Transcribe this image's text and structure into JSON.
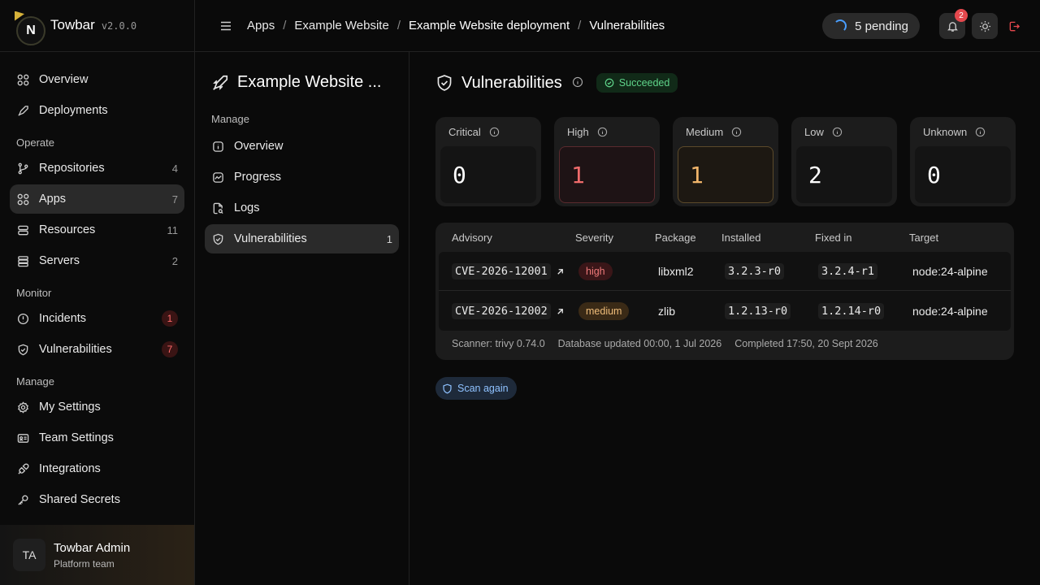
{
  "brand": {
    "name": "Towbar",
    "version": "v2.0.0",
    "logo_letter": "N"
  },
  "sidebar": {
    "top": [
      {
        "label": "Overview",
        "icon": "grid-icon"
      },
      {
        "label": "Deployments",
        "icon": "rocket-icon"
      }
    ],
    "operate_title": "Operate",
    "operate": [
      {
        "label": "Repositories",
        "count": "4"
      },
      {
        "label": "Apps",
        "count": "7"
      },
      {
        "label": "Resources",
        "count": "11"
      },
      {
        "label": "Servers",
        "count": "2"
      }
    ],
    "monitor_title": "Monitor",
    "monitor": [
      {
        "label": "Incidents",
        "count": "1"
      },
      {
        "label": "Vulnerabilities",
        "count": "7"
      }
    ],
    "manage_title": "Manage",
    "manage": [
      {
        "label": "My Settings"
      },
      {
        "label": "Team Settings"
      },
      {
        "label": "Integrations"
      },
      {
        "label": "Shared Secrets"
      }
    ],
    "user": {
      "initials": "TA",
      "name": "Towbar Admin",
      "team": "Platform team"
    }
  },
  "header": {
    "breadcrumbs": [
      "Apps",
      "Example Website",
      "Example Website deployment",
      "Vulnerabilities"
    ],
    "pending": "5 pending",
    "notif_count": "2"
  },
  "subnav": {
    "title": "Example Website ...",
    "section": "Manage",
    "items": [
      {
        "label": "Overview"
      },
      {
        "label": "Progress"
      },
      {
        "label": "Logs"
      },
      {
        "label": "Vulnerabilities",
        "count": "1"
      }
    ]
  },
  "main": {
    "title": "Vulnerabilities",
    "status": "Succeeded",
    "cards": [
      {
        "label": "Critical",
        "value": "0"
      },
      {
        "label": "High",
        "value": "1"
      },
      {
        "label": "Medium",
        "value": "1"
      },
      {
        "label": "Low",
        "value": "2"
      },
      {
        "label": "Unknown",
        "value": "0"
      }
    ],
    "table": {
      "columns": [
        "Advisory",
        "Severity",
        "Package",
        "Installed",
        "Fixed in",
        "Target"
      ],
      "rows": [
        {
          "advisory": "CVE-2026-12001",
          "severity": "high",
          "package": "libxml2",
          "installed": "3.2.3-r0",
          "fixed": "3.2.4-r1",
          "target": "node:24-alpine"
        },
        {
          "advisory": "CVE-2026-12002",
          "severity": "medium",
          "package": "zlib",
          "installed": "1.2.13-r0",
          "fixed": "1.2.14-r0",
          "target": "node:24-alpine"
        }
      ],
      "footer": [
        "Scanner: trivy 0.74.0",
        "Database updated 00:00, 1 Jul 2026",
        "Completed 17:50, 20 Sept 2026"
      ]
    },
    "scan_again": "Scan again"
  },
  "colors": {
    "accent_blue": "#4a9eff",
    "success": "#5fd48a",
    "danger": "#e5484d",
    "warning": "#f0b46a"
  }
}
